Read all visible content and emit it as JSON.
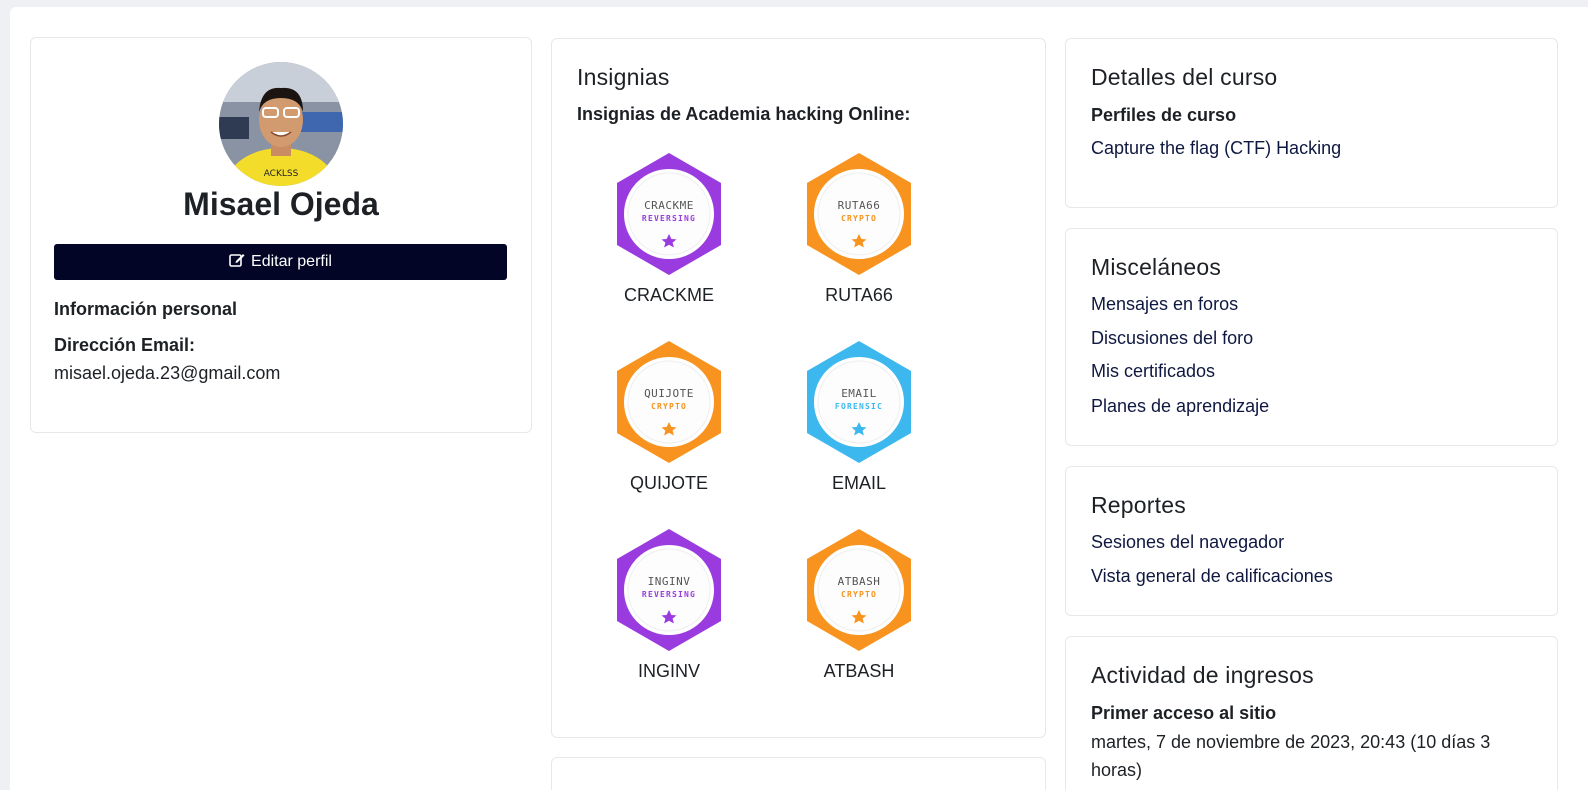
{
  "profile": {
    "name": "Misael Ojeda",
    "edit_label": "Editar perfil",
    "personal_info_label": "Información personal",
    "email_label": "Dirección Email:",
    "email_value": "misael.ojeda.23@gmail.com"
  },
  "badges": {
    "title": "Insignias",
    "subtitle": "Insignias de Academia hacking Online:",
    "items": [
      {
        "name": "CRACKME",
        "logo_text": "CRACKME",
        "category": "REVERSING",
        "color": "#9a3be0"
      },
      {
        "name": "RUTA66",
        "logo_text": "RUTA66",
        "category": "CRYPTO",
        "color": "#f7931e"
      },
      {
        "name": "QUIJOTE",
        "logo_text": "QUIJOTE",
        "category": "CRYPTO",
        "color": "#f7931e"
      },
      {
        "name": "EMAIL",
        "logo_text": "EMAIL",
        "category": "FORENSIC",
        "color": "#3db8ee"
      },
      {
        "name": "INGINV",
        "logo_text": "INGINV",
        "category": "REVERSING",
        "color": "#9a3be0"
      },
      {
        "name": "ATBASH",
        "logo_text": "ATBASH",
        "category": "CRYPTO",
        "color": "#f7931e"
      }
    ]
  },
  "course_details": {
    "title": "Detalles del curso",
    "profiles_label": "Perfiles de curso",
    "course_link": "Capture the flag (CTF) Hacking"
  },
  "misc": {
    "title": "Misceláneos",
    "links": [
      "Mensajes en foros",
      "Discusiones del foro",
      "Mis certificados",
      "Planes de aprendizaje"
    ]
  },
  "reports": {
    "title": "Reportes",
    "links": [
      "Sesiones del navegador",
      "Vista general de calificaciones"
    ]
  },
  "activity": {
    "title": "Actividad de ingresos",
    "first_access_label": "Primer acceso al sitio",
    "first_access_value": "martes, 7 de noviembre de 2023, 20:43  (10 días 3 horas)"
  },
  "colors": {
    "button_bg": "#020526",
    "link": "#0f1840",
    "reversing": "#9a3be0",
    "crypto": "#f7931e",
    "forensic": "#3db8ee"
  }
}
